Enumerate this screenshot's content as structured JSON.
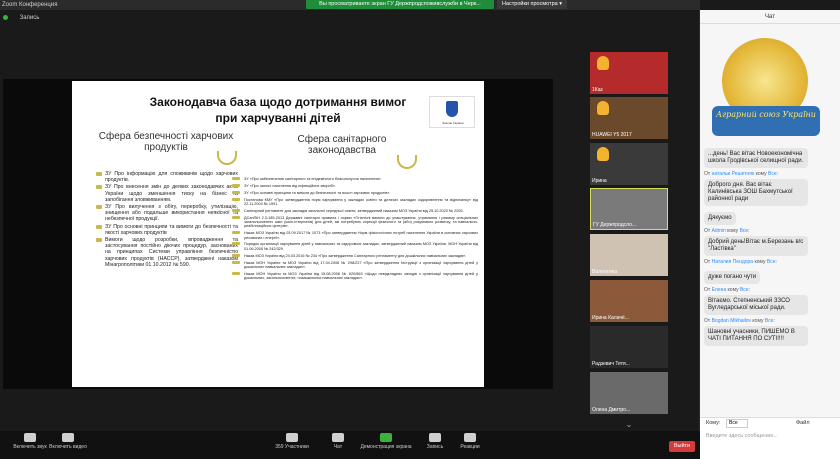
{
  "window": {
    "title": "Zoom Конференция",
    "recording_label": "Запись"
  },
  "share_bar": {
    "viewing": "Вы просматриваете экран ГУ Держпродспоживслужби в Черк...",
    "view_options": "Настройки просмотра ▾"
  },
  "slide": {
    "title_line1": "Законодавча база щодо дотримання вимог",
    "title_line2": "при харчуванні дітей",
    "emblem_caption": "Закони України",
    "left_heading": "Сфера безпечності харчових продуктів",
    "right_heading": "Сфера санітарного законодавства",
    "left_items": [
      "ЗУ Про інформацію для споживачів щодо харчових продуктів.",
      "ЗУ Про внесення змін до деяких законодавчих актів України щодо зменшення тиску на бізнес та запобігання зловживанням.",
      "ЗУ Про вилучення з обігу, переробку, утилізацію, знищення або подальше використання неякісної та небезпечної продукції.",
      "ЗУ Про основні принципи та вимоги до безпечності та якості харчових продуктів",
      "Вимоги щодо розробки, впровадження та застосування постійно діючих процедур, заснованих на принципах Системи управління безпечністю харчових продуктів (НАССР), затверджені наказом Мінагрополітики 01.10.2012 № 590."
    ],
    "right_items": [
      "ЗУ «Про забезпечення санітарного та епідемічного благополуччя населення».",
      "ЗУ «Про захист населення від інфекційних хвороб».",
      "ЗУ «Про основні принципи та вимоги до безпечності та якості харчових продуктів».",
      "Постанова КМУ «Про затвердження норм харчування у закладах освіти та дитячих закладах оздоровлення та відпочинку» від 22.11.2004 № 1591.",
      "Санітарний регламент для закладів загальної середньої освіти, затверджений наказом МОЗ України від 25.10.2020 № 2205.",
      "ДСанПіН 2.3-185-2013 Державні санітарні правила і норми «Гігієнічні вимоги до улаштування, утримання і режиму спеціальних загальноосвітніх шкіл (шкіл-інтернатів) для дітей, які потребують корекції фізичного та (або) розумового розвитку, та навчально-реабілітаційних центрів».",
      "Наказ МОЗ України від 03.09.2017 № 1073 «Про затвердження Норм фізіологічних потреб населення України в основних харчових речовинах і енергії».",
      "Порядок організації харчування дітей у навчальних та оздоровчих закладах, затверджений наказом МОЗ України, МОН України від 01.06.2005 № 242/329.",
      "Наказ МОЗ України від 24.03.2016 № 234 «Про затвердження Санітарного регламенту для дошкільних навчальних закладів».",
      "Наказ МОН України та МОЗ України від 17.04.2006 № 298/227 «Про затвердження Інструкції з організації харчування дітей у дошкільних навчальних закладах».",
      "Наказ МОН України та МОЗ України від 15.08.2006 № 620/563 «Щодо невідкладних заходів з організації харчування дітей у дошкільних, загальноосвітніх, позашкільних навчальних закладах»."
    ]
  },
  "participants": [
    {
      "name": "1Каз",
      "hand": true
    },
    {
      "name": "HUAWEI Y5 2017",
      "hand": true
    },
    {
      "name": "Ирина",
      "hand": true
    },
    {
      "name": "ГУ Держпродсло...",
      "hand": false
    },
    {
      "name": "Валентина",
      "hand": false
    },
    {
      "name": "Ирина Калачё...",
      "hand": false
    },
    {
      "name": "Радзевич Тетя...",
      "hand": false
    },
    {
      "name": "Олена Дмитро...",
      "hand": false
    }
  ],
  "chat": {
    "header": "Чат",
    "logo_text": "Аграрний союз України",
    "messages": [
      {
        "from": "",
        "to": "",
        "text": "...день! Вас вітає Новоекономічна школа Гродівської селищної ради."
      },
      {
        "from": "натальи Решетняк",
        "to": "Все",
        "text": "Доброго дня. Вас вітає Калинівська ЗОШ Бахмутської районної ради"
      },
      {
        "from": "",
        "to": "",
        "text": "Дякуємо"
      },
      {
        "from": "Admin",
        "to": "Все",
        "text": "Добрий день!Вітає м.Березань в/с \"Ластівка\""
      },
      {
        "from": "Наталия Пендора",
        "to": "Все",
        "text": "дуже погано чути"
      },
      {
        "from": "Елена",
        "to": "Все",
        "text": "Вітаємо. Степненський ЗЗСО Вугледарської міської ради."
      },
      {
        "from": "Bogdan Mikhailov",
        "to": "Все",
        "text": "Шановні учасники, ПИШЕМО В ЧАТІ ПИТАННЯ ПО СУТІ!!!!"
      }
    ],
    "to_label": "Кому:",
    "to_value": "Все",
    "file_label": "Файл",
    "input_placeholder": "Введите здесь сообщение..."
  },
  "toolbar": {
    "audio": "Включить звук",
    "video": "Включить видео",
    "participants": "Участники",
    "participants_count": "359",
    "chat": "Чат",
    "share": "Демонстрация экрана",
    "record": "Запись",
    "reactions": "Реакции",
    "exit": "Выйти"
  }
}
